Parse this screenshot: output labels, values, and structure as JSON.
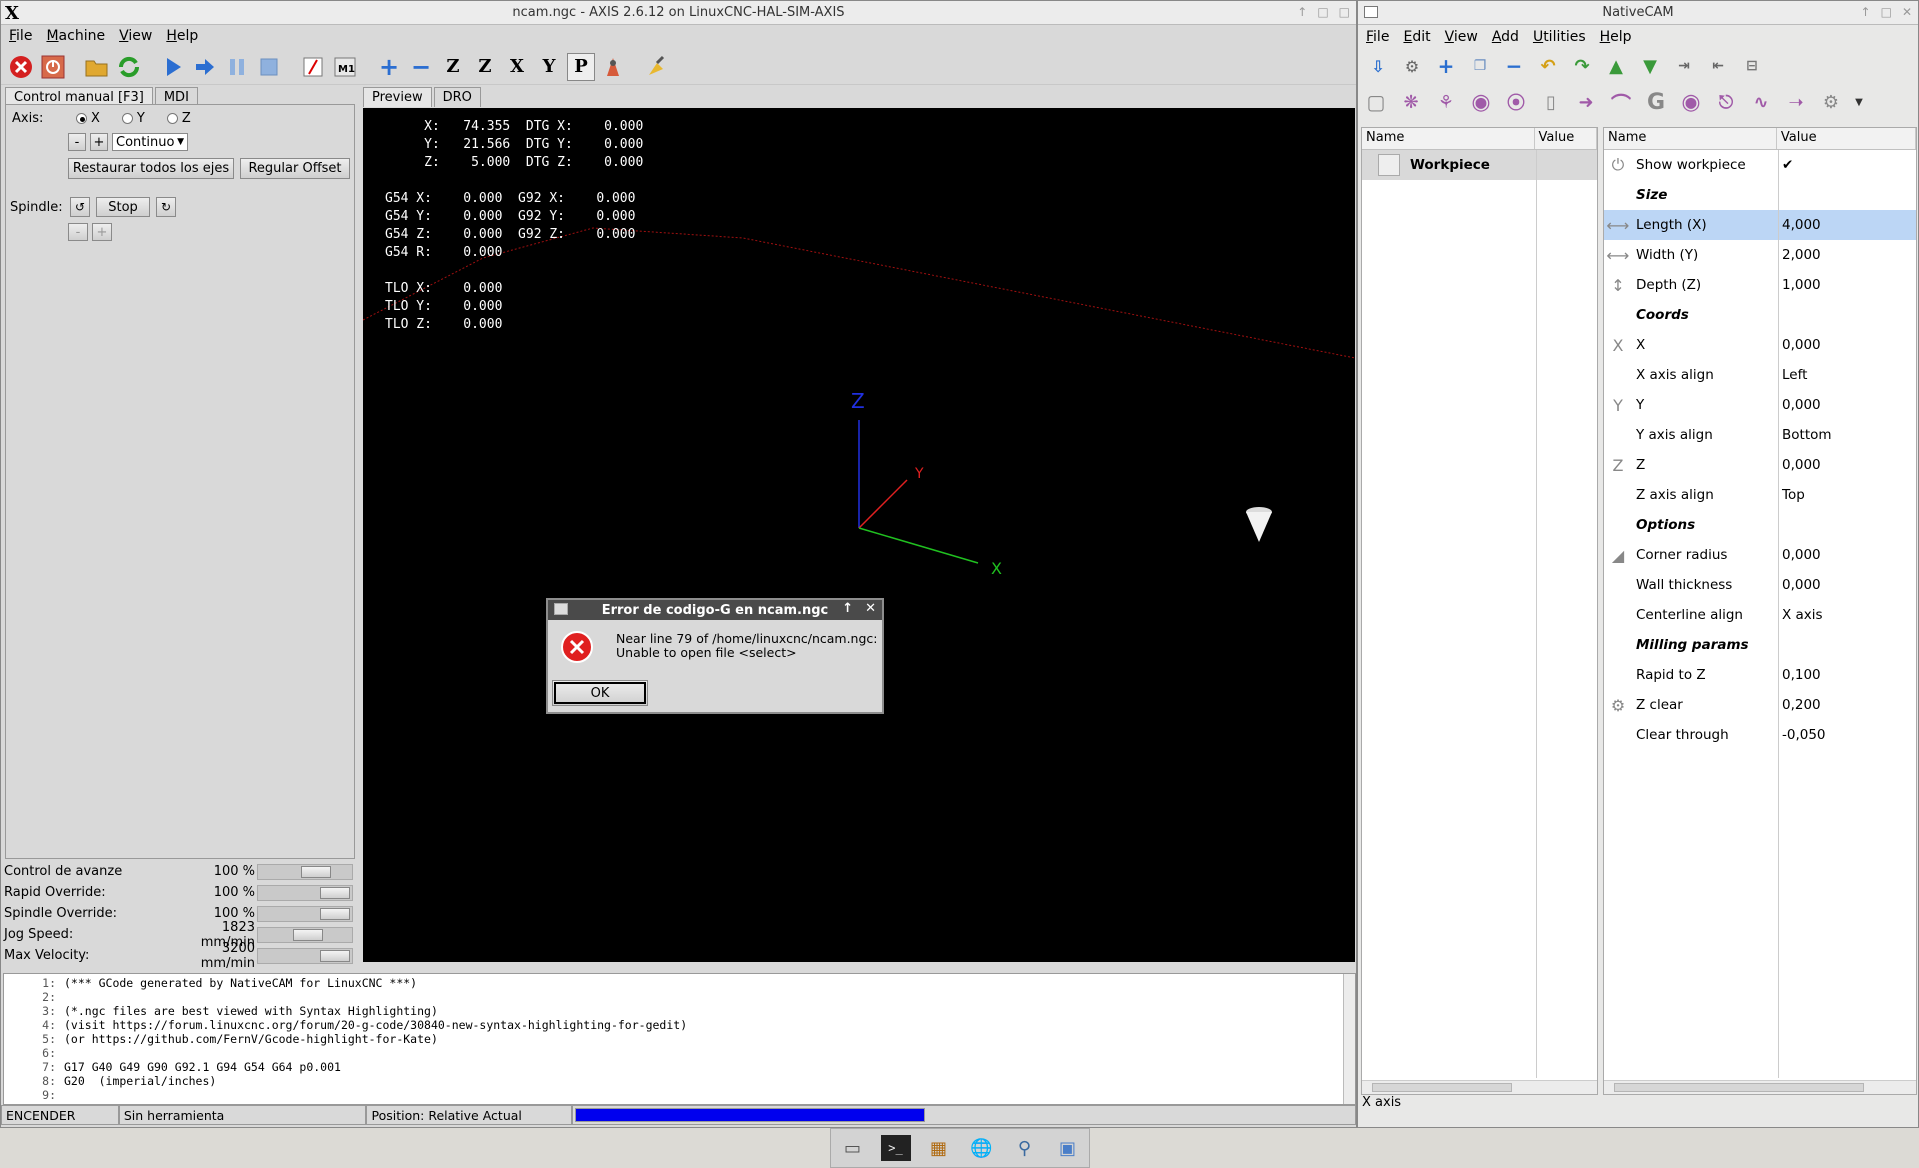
{
  "axis_window": {
    "title": "ncam.ngc - AXIS 2.6.12 on LinuxCNC-HAL-SIM-AXIS",
    "menu": [
      "File",
      "Machine",
      "View",
      "Help"
    ],
    "left_tabs": [
      "Control manual [F3]",
      "MDI"
    ],
    "axis_label": "Axis:",
    "axes": [
      "X",
      "Y",
      "Z"
    ],
    "selected_axis": "X",
    "jog_minus": "-",
    "jog_plus": "+",
    "jog_mode": "Continuo",
    "restore_all_btn": "Restaurar todos los ejes",
    "offset_btn": "Regular Offset",
    "spindle_label": "Spindle:",
    "spindle_stop": "Stop",
    "spindle_minus": "-",
    "spindle_plus": "+",
    "preview_tabs": [
      "Preview",
      "DRO"
    ],
    "sliders": [
      {
        "label": "Control de avanze",
        "value": "100 %",
        "level": 0.7
      },
      {
        "label": "Rapid Override:",
        "value": "100 %",
        "level": 1.0
      },
      {
        "label": "Spindle Override:",
        "value": "100 %",
        "level": 1.0
      },
      {
        "label": "Jog Speed:",
        "value": "1823 mm/min",
        "level": 0.57
      },
      {
        "label": "Max Velocity:",
        "value": "3200 mm/min",
        "level": 1.0
      }
    ],
    "dro_text": "     X:   74.355  DTG X:    0.000\n     Y:   21.566  DTG Y:    0.000\n     Z:    5.000  DTG Z:    0.000\n\nG54 X:    0.000  G92 X:    0.000\nG54 Y:    0.000  G92 Y:    0.000\nG54 Z:    0.000  G92 Z:    0.000\nG54 R:    0.000\n\nTLO X:    0.000\nTLO Y:    0.000\nTLO Z:    0.000",
    "axis_letters": {
      "z": "Z",
      "y": "Y",
      "x": "X"
    },
    "gcode_lines": [
      {
        "n": "1:",
        "t": "(*** GCode generated by NativeCAM for LinuxCNC ***)"
      },
      {
        "n": "2:",
        "t": ""
      },
      {
        "n": "3:",
        "t": "(*.ngc files are best viewed with Syntax Highlighting)"
      },
      {
        "n": "4:",
        "t": "(visit https://forum.linuxcnc.org/forum/20-g-code/30840-new-syntax-highlighting-for-gedit)"
      },
      {
        "n": "5:",
        "t": "(or https://github.com/FernV/Gcode-highlight-for-Kate)"
      },
      {
        "n": "6:",
        "t": ""
      },
      {
        "n": "7:",
        "t": "G17 G40 G49 G90 G92.1 G94 G54 G64 p0.001"
      },
      {
        "n": "8:",
        "t": "G20  (imperial/inches)"
      },
      {
        "n": "9:",
        "t": ""
      }
    ],
    "status": {
      "power": "ENCENDER",
      "tool": "Sin herramienta",
      "position": "Position: Relative Actual"
    },
    "colors": {
      "progress": "#0000ee"
    }
  },
  "dialog": {
    "title": "Error de codigo-G en ncam.ngc",
    "message_line1": "Near line 79 of /home/linuxcnc/ncam.ngc:",
    "message_line2": "Unable to open file <select>",
    "ok": "OK"
  },
  "ncam": {
    "title": "NativeCAM",
    "menu": [
      "File",
      "Edit",
      "View",
      "Add",
      "Utilities",
      "Help"
    ],
    "tree_headers": [
      "Name",
      "Value"
    ],
    "tree_item": "Workpiece",
    "prop_headers": [
      "Name",
      "Value"
    ],
    "props": [
      {
        "name": "Show workpiece",
        "value": "✔",
        "icon": "power-icon",
        "type": "item"
      },
      {
        "name": "Size",
        "value": "",
        "type": "head"
      },
      {
        "name": "Length (X)",
        "value": "4,000",
        "icon": "arrow-horizontal-icon",
        "type": "item",
        "selected": true
      },
      {
        "name": "Width (Y)",
        "value": "2,000",
        "icon": "arrow-horizontal-icon",
        "type": "item"
      },
      {
        "name": "Depth (Z)",
        "value": "1,000",
        "icon": "arrow-vertical-icon",
        "type": "item"
      },
      {
        "name": "Coords",
        "value": "",
        "type": "head"
      },
      {
        "name": "X",
        "value": "0,000",
        "icon": "x-axis-icon",
        "type": "item"
      },
      {
        "name": "X axis align",
        "value": "Left",
        "type": "item"
      },
      {
        "name": "Y",
        "value": "0,000",
        "icon": "y-axis-icon",
        "type": "item"
      },
      {
        "name": "Y axis align",
        "value": "Bottom",
        "type": "item"
      },
      {
        "name": "Z",
        "value": "0,000",
        "icon": "z-axis-icon",
        "type": "item"
      },
      {
        "name": "Z axis align",
        "value": "Top",
        "type": "item"
      },
      {
        "name": "Options",
        "value": "",
        "type": "head"
      },
      {
        "name": "Corner radius",
        "value": "0,000",
        "icon": "corner-radius-icon",
        "type": "item"
      },
      {
        "name": "Wall thickness",
        "value": "0,000",
        "type": "item"
      },
      {
        "name": "Centerline align",
        "value": "X axis",
        "type": "item"
      },
      {
        "name": "Milling params",
        "value": "",
        "type": "head"
      },
      {
        "name": "Rapid to Z",
        "value": "0,100",
        "type": "item"
      },
      {
        "name": "Z clear",
        "value": "0,200",
        "icon": "z-clear-icon",
        "type": "item"
      },
      {
        "name": "Clear through",
        "value": "-0,050",
        "type": "item"
      }
    ],
    "status_text": "X axis"
  }
}
